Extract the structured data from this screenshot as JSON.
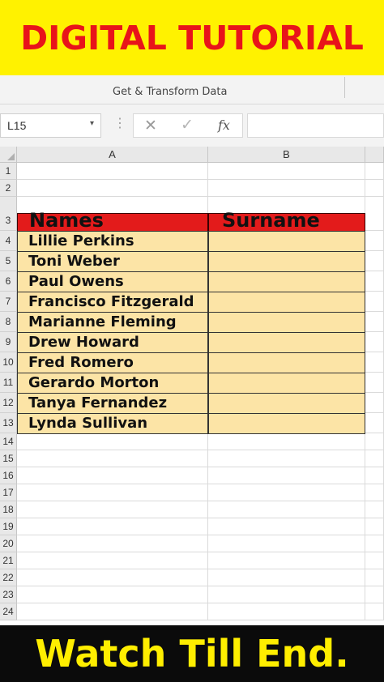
{
  "top_banner": {
    "text": "DIGITAL TUTORIAL"
  },
  "ribbon": {
    "group_label": "Get & Transform Data"
  },
  "formula_bar": {
    "name_box": "L15",
    "name_box_arrow": "▾",
    "cancel_glyph": "✕",
    "enter_glyph": "✓",
    "fx_label": "fx",
    "formula": ""
  },
  "sheet": {
    "columns": [
      "A",
      "B"
    ],
    "rows": [
      "1",
      "2",
      "3",
      "4",
      "5",
      "6",
      "7",
      "8",
      "9",
      "10",
      "11",
      "12",
      "13",
      "14",
      "15",
      "16",
      "17",
      "18",
      "19",
      "20",
      "21",
      "22",
      "23",
      "24"
    ],
    "headers": {
      "names": "Names",
      "surname": "Surname"
    },
    "names": [
      "Lillie Perkins",
      "Toni Weber",
      "Paul Owens",
      "Francisco Fitzgerald",
      "Marianne Fleming",
      "Drew Howard",
      "Fred Romero",
      "Gerardo Morton",
      "Tanya Fernandez",
      "Lynda Sullivan"
    ]
  },
  "bottom_banner": {
    "text": "Watch Till End."
  },
  "colors": {
    "banner_yellow": "#fff200",
    "banner_red_text": "#e8141a",
    "header_red": "#e31b1b",
    "data_fill": "#fce4a6",
    "bottom_bg": "#0b0b0b",
    "bottom_text": "#ffee00"
  }
}
